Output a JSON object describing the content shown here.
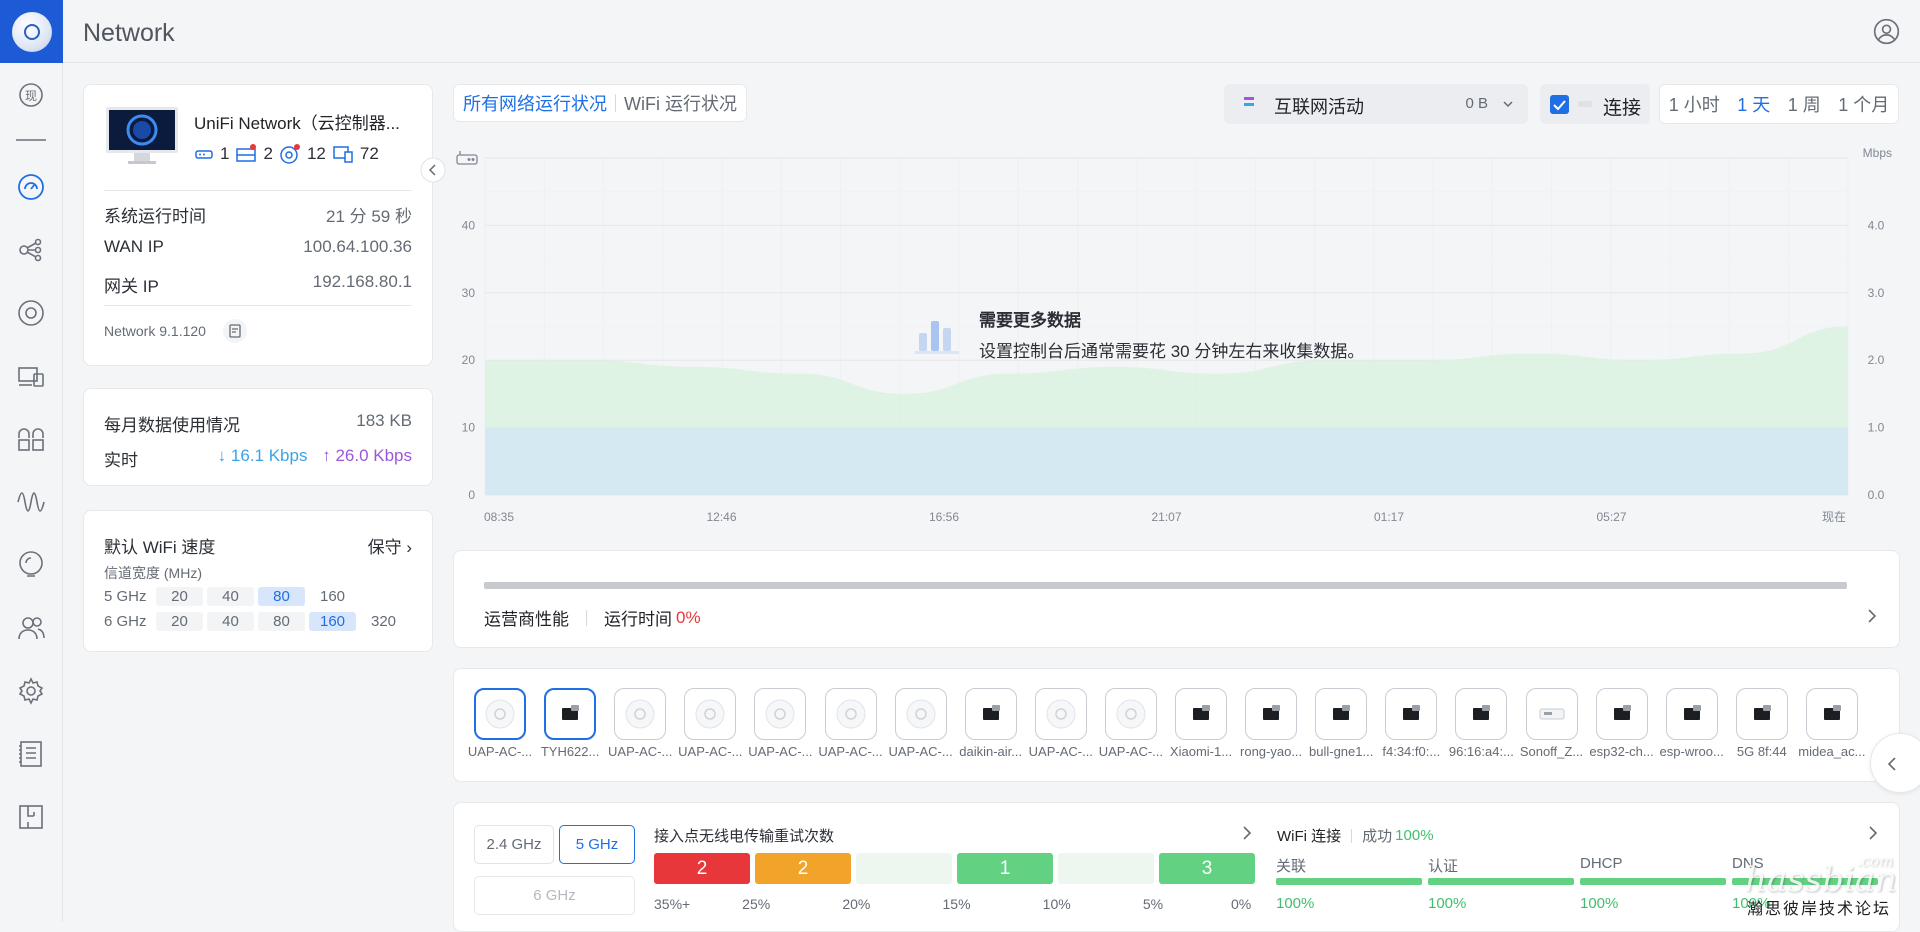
{
  "app": {
    "title": "Network"
  },
  "console": {
    "name": "UniFi Network（云控制器...",
    "counts": [
      {
        "icon": "gateway-icon",
        "value": "1"
      },
      {
        "icon": "switch-icon",
        "value": "2"
      },
      {
        "icon": "access-point-icon",
        "value": "12"
      },
      {
        "icon": "client-devices-icon",
        "value": "72"
      }
    ],
    "uptime_label": "系统运行时间",
    "uptime_value": "21 分 59 秒",
    "wan_label": "WAN IP",
    "wan_value": "100.64.100.36",
    "gateway_label": "网关 IP",
    "gateway_value": "192.168.80.1",
    "version": "Network 9.1.120"
  },
  "usage": {
    "monthly_label": "每月数据使用情况",
    "monthly_value": "183 KB",
    "realtime_label": "实时",
    "down": "16.1 Kbps",
    "up": "26.0 Kbps"
  },
  "wifi_speed": {
    "title": "默认 WiFi 速度",
    "mode": "保守",
    "subtitle": "信道宽度 (MHz)",
    "bands": [
      {
        "label": "5 GHz",
        "options": [
          "20",
          "40",
          "80",
          "160"
        ],
        "selected": "80"
      },
      {
        "label": "6 GHz",
        "options": [
          "20",
          "40",
          "80",
          "160",
          "320"
        ],
        "selected": "160"
      }
    ]
  },
  "tabs": {
    "all": "所有网络运行状况",
    "wifi": "WiFi 运行状况"
  },
  "activity": {
    "label": "互联网活动",
    "value": "0 B"
  },
  "connect": {
    "label": "连接"
  },
  "ranges": [
    "1 小时",
    "1 天",
    "1 周",
    "1 个月"
  ],
  "range_selected": "1 天",
  "chart_data": {
    "type": "area",
    "title": "",
    "right_unit": "Mbps",
    "yticks_left": [
      "40",
      "30",
      "20",
      "10",
      "0"
    ],
    "yticks_right": [
      "4.0",
      "3.0",
      "2.0",
      "1.0",
      "0.0"
    ],
    "xticks": [
      "08:35",
      "12:46",
      "16:56",
      "21:07",
      "01:17",
      "05:27",
      "现在"
    ],
    "ylim": [
      0,
      50
    ],
    "series": [
      {
        "values": [
          20,
          20,
          19,
          18,
          15,
          18,
          19,
          18,
          20,
          20,
          21,
          20,
          21,
          25
        ]
      },
      {
        "values": [
          10,
          10,
          10,
          10,
          10,
          10,
          10,
          10,
          10,
          10,
          10,
          10,
          10,
          10
        ]
      }
    ],
    "overlay_title": "需要更多数据",
    "overlay_text": "设置控制台后通常需要花 30 分钟左右来收集数据。"
  },
  "isp": {
    "label": "运营商性能",
    "uptime_label": "运行时间",
    "uptime_value": "0%"
  },
  "devices": [
    "UAP-AC-...",
    "TYH622...",
    "UAP-AC-...",
    "UAP-AC-...",
    "UAP-AC-...",
    "UAP-AC-...",
    "UAP-AC-...",
    "daikin-air...",
    "UAP-AC-...",
    "UAP-AC-...",
    "Xiaomi-1...",
    "rong-yao...",
    "bull-gne1...",
    "f4:34:f0:...",
    "96:16:a4:...",
    "Sonoff_Z...",
    "esp32-ch...",
    "esp-wroo...",
    "5G 8f:44",
    "midea_ac..."
  ],
  "bands_select": {
    "b24": "2.4 GHz",
    "b5": "5 GHz",
    "b6": "6 GHz"
  },
  "retry": {
    "title": "接入点无线电传输重试次数",
    "cells": [
      "2",
      "2",
      "",
      "1",
      "",
      "3"
    ],
    "colors": [
      "#e8373a",
      "#f2a42a",
      "#edf7ef",
      "#62d182",
      "#edf7ef",
      "#62d182"
    ],
    "scale": [
      "35%+",
      "25%",
      "20%",
      "15%",
      "10%",
      "5%",
      "0%"
    ]
  },
  "wifi_conn": {
    "title": "WiFi 连接",
    "success_label": "成功",
    "success_value": "100%",
    "stages": [
      {
        "label": "关联",
        "value": "100%"
      },
      {
        "label": "认证",
        "value": "100%"
      },
      {
        "label": "DHCP",
        "value": "100%"
      },
      {
        "label": "DNS",
        "value": "100%"
      }
    ]
  },
  "watermark": {
    "brand": "hassbian",
    "domain": ".com",
    "sub": "瀚思彼岸技术论坛"
  }
}
